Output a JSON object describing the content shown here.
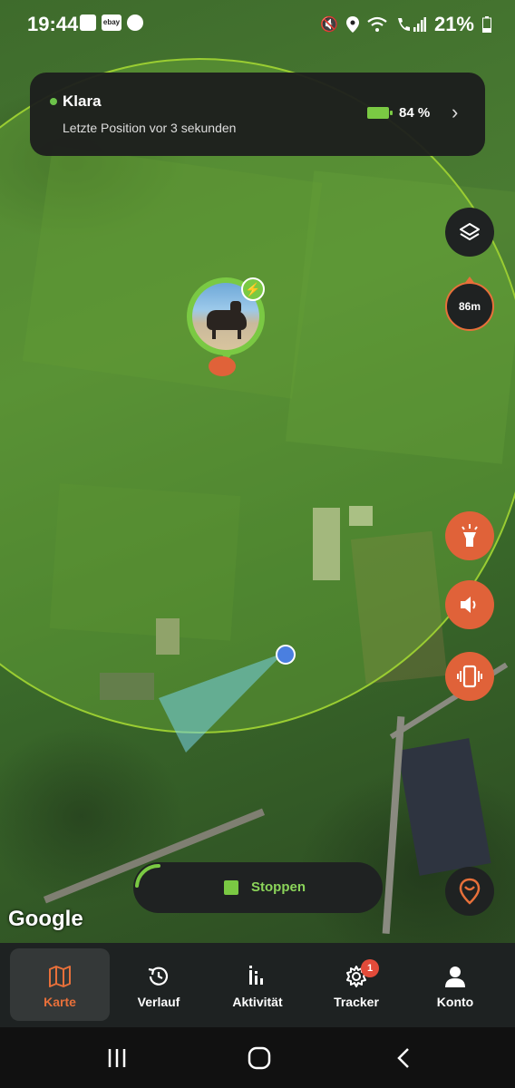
{
  "status_bar": {
    "time": "19:44",
    "ebay_label": "ebay",
    "battery_percent": "21%",
    "left_icons": [
      "image-icon",
      "ebay-icon",
      "timer-icon"
    ],
    "right_icons": [
      "mute-icon",
      "location-icon",
      "wifi-icon",
      "call-signal-icon",
      "battery-icon"
    ]
  },
  "tracker_card": {
    "name": "Klara",
    "online": true,
    "last_position": "Letzte Position vor 3 sekunden",
    "battery": "84 %"
  },
  "map": {
    "distance_label": "86m",
    "google_logo": "Google",
    "side_buttons": [
      "layers-icon",
      "flashlight-icon",
      "sound-icon",
      "vibrate-icon"
    ],
    "bottom_button": "locate-pet-icon"
  },
  "live_tracking": {
    "button_label": "Stoppen"
  },
  "tabs": [
    {
      "label": "Karte",
      "icon": "map-icon",
      "active": true
    },
    {
      "label": "Verlauf",
      "icon": "history-icon",
      "active": false
    },
    {
      "label": "Aktivität",
      "icon": "activity-icon",
      "active": false
    },
    {
      "label": "Tracker",
      "icon": "gear-icon",
      "active": false,
      "badge": "1"
    },
    {
      "label": "Konto",
      "icon": "person-icon",
      "active": false
    }
  ],
  "colors": {
    "accent": "#e8703a",
    "green": "#7ac943",
    "dark": "#1f2222"
  }
}
